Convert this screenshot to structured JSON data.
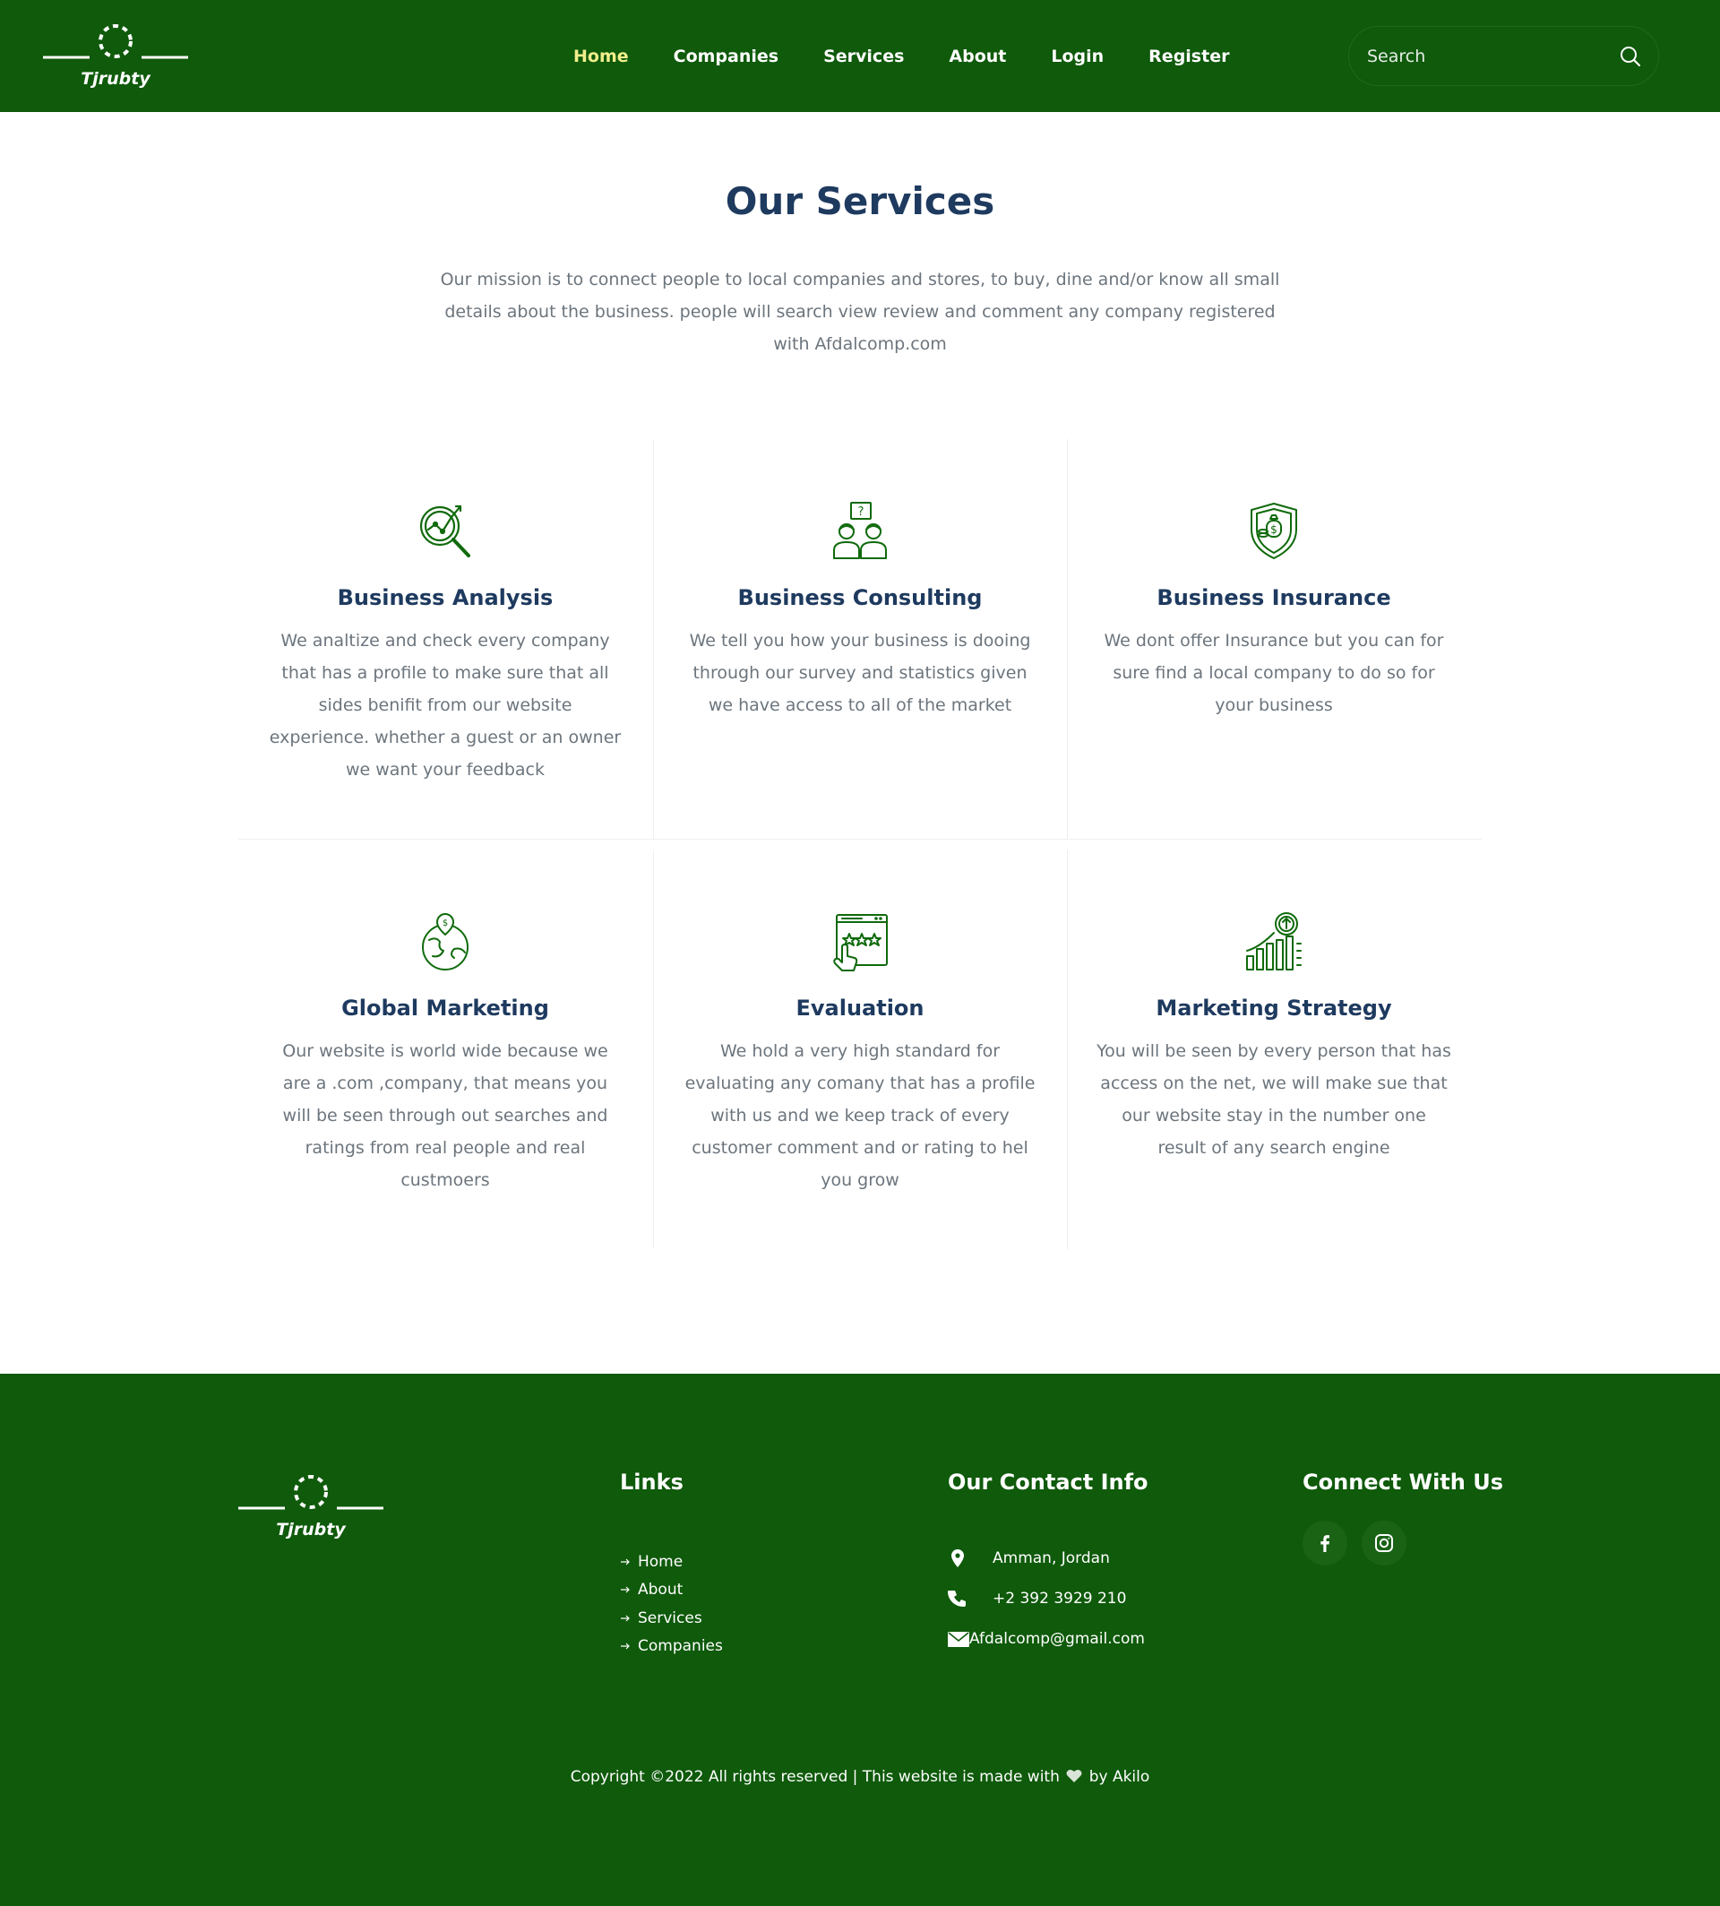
{
  "header": {
    "brand_name": "Tjrubty",
    "nav": [
      {
        "label": "Home",
        "active": true
      },
      {
        "label": "Companies"
      },
      {
        "label": "Services"
      },
      {
        "label": "About"
      },
      {
        "label": "Login"
      },
      {
        "label": "Register"
      }
    ],
    "search": {
      "placeholder": "Search",
      "value": ""
    }
  },
  "services": {
    "title": "Our Services",
    "description": "Our mission is to connect people to local companies and stores, to buy, dine and/or know all small details about the business. people will search view review and comment any company registered with Afdalcomp.com",
    "items": [
      {
        "icon": "analysis-magnifier-icon",
        "title": "Business Analysis",
        "text": "We analtize and check every company that has a profile to make sure that all sides benifit from our website experience. whether a guest or an owner we want your feedback"
      },
      {
        "icon": "consulting-people-icon",
        "title": "Business Consulting",
        "text": "We tell you how your business is dooing through our survey and statistics given we have access to all of the market"
      },
      {
        "icon": "insurance-shield-icon",
        "title": "Business Insurance",
        "text": "We dont offer Insurance but you can for sure find a local company to do so for your business"
      },
      {
        "icon": "global-marketing-icon",
        "title": "Global Marketing",
        "text": "Our website is world wide because we are a .com ,company, that means you will be seen through out searches and ratings from real people and real custmoers"
      },
      {
        "icon": "evaluation-rating-icon",
        "title": "Evaluation",
        "text": "We hold a very high standard for evaluating any comany that has a profile with us and we keep track of every customer comment and or rating to hel you grow"
      },
      {
        "icon": "strategy-growth-chart-icon",
        "title": "Marketing Strategy",
        "text": "You will be seen by every person that has access on the net, we will make sue that our website stay in the number one result of any search engine"
      }
    ]
  },
  "footer": {
    "links_title": "Links",
    "links": [
      "Home",
      "About",
      "Services",
      "Companies"
    ],
    "contact_title": "Our Contact Info",
    "contact": {
      "address": "Amman, Jordan",
      "phone": "+2 392 3929 210",
      "email": "Afdalcomp@gmail.com"
    },
    "connect_title": "Connect With Us",
    "social": [
      "facebook-icon",
      "instagram-icon"
    ],
    "copyright_prefix": "Copyright ©2022 All rights reserved | This website is made with",
    "copyright_suffix": "by Akilo"
  },
  "colors": {
    "brand_green": "#0f5a0b",
    "active_nav": "#f2ee8c",
    "heading_navy": "#1e3a5f",
    "icon_green": "#0f6a0b",
    "body_gray": "#6c757d"
  }
}
